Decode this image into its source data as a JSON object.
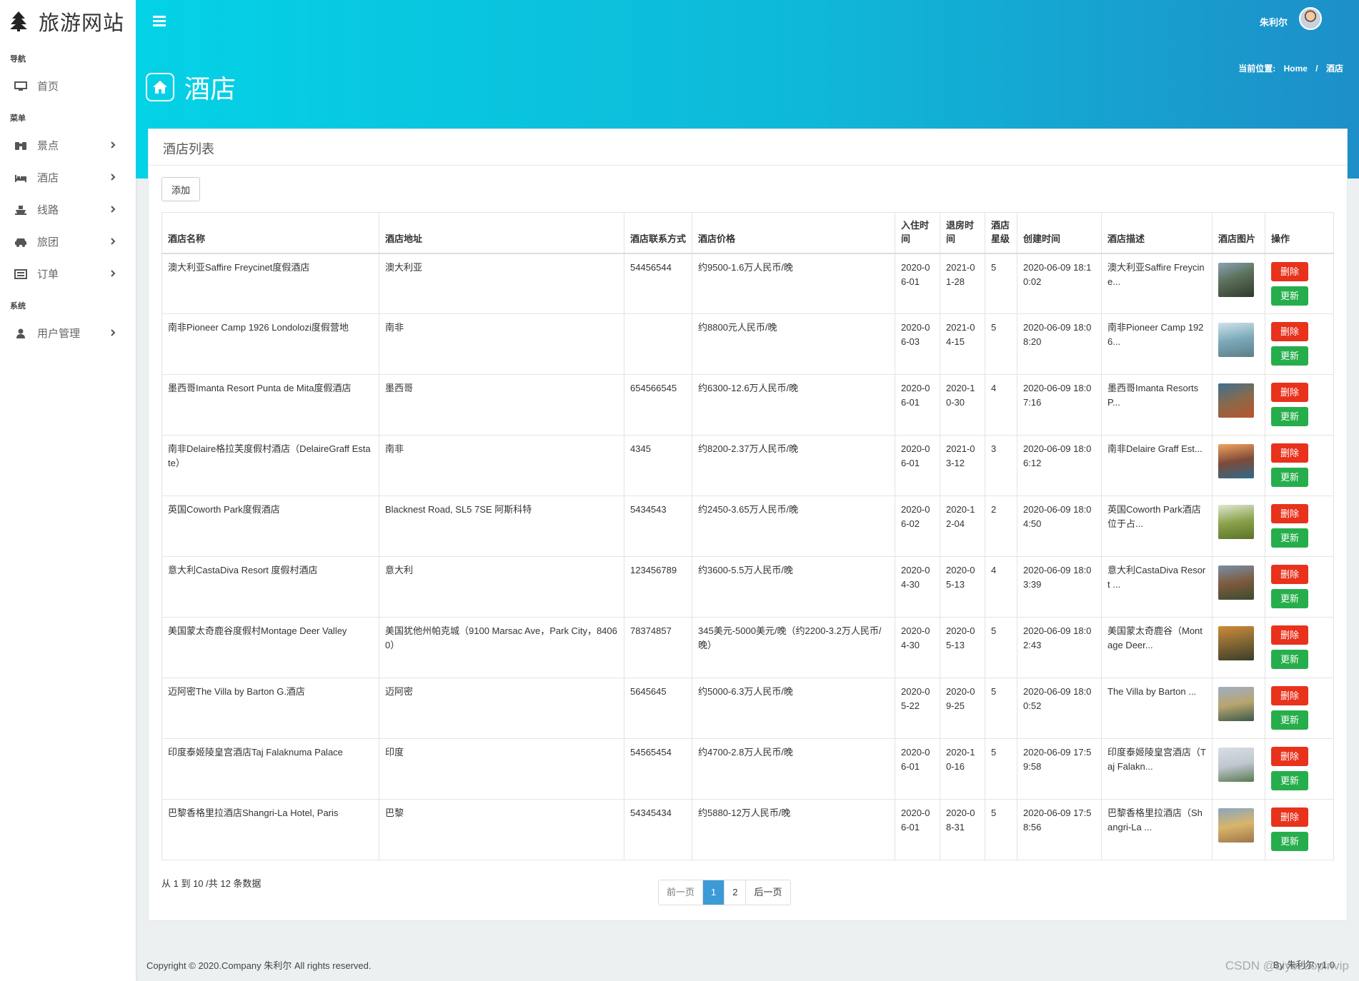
{
  "brand": {
    "title": "旅游网站"
  },
  "sidebar": {
    "sections": {
      "nav": "导航",
      "menu": "菜单",
      "system": "系统"
    },
    "home": "首页",
    "items": [
      {
        "label": "景点",
        "icon": "binoculars-icon"
      },
      {
        "label": "酒店",
        "icon": "bed-icon"
      },
      {
        "label": "线路",
        "icon": "ship-icon"
      },
      {
        "label": "旅团",
        "icon": "car-icon"
      },
      {
        "label": "订单",
        "icon": "list-icon"
      }
    ],
    "user_mgmt": "用户管理"
  },
  "header": {
    "user": "朱利尔",
    "breadcrumb_prefix": "当前位置:",
    "breadcrumb_home": "Home",
    "breadcrumb_sep": "/",
    "breadcrumb_current": "酒店",
    "page_title": "酒店"
  },
  "panel": {
    "title": "酒店列表",
    "add_label": "添加"
  },
  "table": {
    "headers": [
      "酒店名称",
      "酒店地址",
      "酒店联系方式",
      "酒店价格",
      "入住时间",
      "退房时间",
      "酒店星级",
      "创建时间",
      "酒店描述",
      "酒店图片",
      "操作"
    ],
    "delete_label": "删除",
    "update_label": "更新",
    "rows": [
      {
        "name": "澳大利亚Saffire Freycinet度假酒店",
        "address": "澳大利亚",
        "phone": "54456544",
        "price": "约9500-1.6万人民币/晚",
        "checkin": "2020-06-01",
        "checkout": "2021-01-28",
        "stars": "5",
        "created": "2020-06-09 18:10:02",
        "desc": "澳大利亚Saffire Freycine..."
      },
      {
        "name": "南非Pioneer Camp 1926 Londolozi度假营地",
        "address": "南非",
        "phone": "",
        "price": "约8800元人民币/晚",
        "checkin": "2020-06-03",
        "checkout": "2021-04-15",
        "stars": "5",
        "created": "2020-06-09 18:08:20",
        "desc": "南非Pioneer Camp 1926..."
      },
      {
        "name": "墨西哥Imanta Resort Punta de Mita度假酒店",
        "address": "墨西哥",
        "phone": "654566545",
        "price": "约6300-12.6万人民币/晚",
        "checkin": "2020-06-01",
        "checkout": "2020-10-30",
        "stars": "4",
        "created": "2020-06-09 18:07:16",
        "desc": "墨西哥Imanta Resorts P..."
      },
      {
        "name": "南非Delaire格拉芙度假村酒店（DelaireGraff Estate）",
        "address": "南非",
        "phone": "4345",
        "price": "约8200-2.37万人民币/晚",
        "checkin": "2020-06-01",
        "checkout": "2021-03-12",
        "stars": "3",
        "created": "2020-06-09 18:06:12",
        "desc": "南非Delaire Graff Est..."
      },
      {
        "name": "英国Coworth Park度假酒店",
        "address": "Blacknest Road, SL5 7SE 阿斯科特",
        "phone": "5434543",
        "price": "约2450-3.65万人民币/晚",
        "checkin": "2020-06-02",
        "checkout": "2020-12-04",
        "stars": "2",
        "created": "2020-06-09 18:04:50",
        "desc": "英国Coworth Park酒店位于占..."
      },
      {
        "name": "意大利CastaDiva Resort 度假村酒店",
        "address": "意大利",
        "phone": "123456789",
        "price": "约3600-5.5万人民币/晚",
        "checkin": "2020-04-30",
        "checkout": "2020-05-13",
        "stars": "4",
        "created": "2020-06-09 18:03:39",
        "desc": "意大利CastaDiva Resort ..."
      },
      {
        "name": "美国蒙太奇鹿谷度假村Montage Deer Valley",
        "address": "美国犹他州帕克城（9100 Marsac Ave，Park City，84060）",
        "phone": "78374857",
        "price": "345美元-5000美元/晚（约2200-3.2万人民币/晚）",
        "checkin": "2020-04-30",
        "checkout": "2020-05-13",
        "stars": "5",
        "created": "2020-06-09 18:02:43",
        "desc": "美国蒙太奇鹿谷（Montage Deer..."
      },
      {
        "name": "迈阿密The Villa by Barton G.酒店",
        "address": "迈阿密",
        "phone": "5645645",
        "price": "约5000-6.3万人民币/晚",
        "checkin": "2020-05-22",
        "checkout": "2020-09-25",
        "stars": "5",
        "created": "2020-06-09 18:00:52",
        "desc": "The Villa by Barton ..."
      },
      {
        "name": "印度泰姬陵皇宫酒店Taj Falaknuma Palace",
        "address": "印度",
        "phone": "54565454",
        "price": "约4700-2.8万人民币/晚",
        "checkin": "2020-06-01",
        "checkout": "2020-10-16",
        "stars": "5",
        "created": "2020-06-09 17:59:58",
        "desc": "印度泰姬陵皇宫酒店（Taj Falakn..."
      },
      {
        "name": "巴黎香格里拉酒店Shangri-La Hotel, Paris",
        "address": "巴黎",
        "phone": "54345434",
        "price": "约5880-12万人民币/晚",
        "checkin": "2020-06-01",
        "checkout": "2020-08-31",
        "stars": "5",
        "created": "2020-06-09 17:58:56",
        "desc": "巴黎香格里拉酒店（Shangri-La ..."
      }
    ]
  },
  "pagination": {
    "summary": "从 1 到 10 /共 12 条数据",
    "prev": "前一页",
    "pages": [
      "1",
      "2"
    ],
    "next": "后一页"
  },
  "footer": {
    "copyright": "Copyright © 2020.Company 朱利尔 All rights reserved.",
    "right": "By 朱利尔 v1.0",
    "watermark": "CSDN @biyezuopinvip"
  },
  "colors": {
    "header_start": "#04d2e6",
    "header_end": "#1d8fc9",
    "danger": "#e8321c",
    "success": "#27ae4c",
    "page_active": "#3c9ad6"
  }
}
